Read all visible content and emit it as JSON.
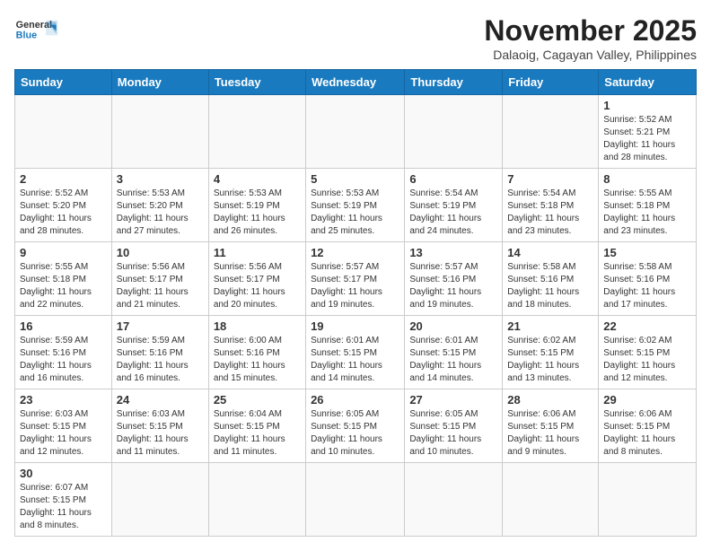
{
  "header": {
    "logo_general": "General",
    "logo_blue": "Blue",
    "month_title": "November 2025",
    "subtitle": "Dalaoig, Cagayan Valley, Philippines"
  },
  "weekdays": [
    "Sunday",
    "Monday",
    "Tuesday",
    "Wednesday",
    "Thursday",
    "Friday",
    "Saturday"
  ],
  "weeks": [
    [
      {
        "day": "",
        "info": ""
      },
      {
        "day": "",
        "info": ""
      },
      {
        "day": "",
        "info": ""
      },
      {
        "day": "",
        "info": ""
      },
      {
        "day": "",
        "info": ""
      },
      {
        "day": "",
        "info": ""
      },
      {
        "day": "1",
        "info": "Sunrise: 5:52 AM\nSunset: 5:21 PM\nDaylight: 11 hours\nand 28 minutes."
      }
    ],
    [
      {
        "day": "2",
        "info": "Sunrise: 5:52 AM\nSunset: 5:20 PM\nDaylight: 11 hours\nand 28 minutes."
      },
      {
        "day": "3",
        "info": "Sunrise: 5:53 AM\nSunset: 5:20 PM\nDaylight: 11 hours\nand 27 minutes."
      },
      {
        "day": "4",
        "info": "Sunrise: 5:53 AM\nSunset: 5:19 PM\nDaylight: 11 hours\nand 26 minutes."
      },
      {
        "day": "5",
        "info": "Sunrise: 5:53 AM\nSunset: 5:19 PM\nDaylight: 11 hours\nand 25 minutes."
      },
      {
        "day": "6",
        "info": "Sunrise: 5:54 AM\nSunset: 5:19 PM\nDaylight: 11 hours\nand 24 minutes."
      },
      {
        "day": "7",
        "info": "Sunrise: 5:54 AM\nSunset: 5:18 PM\nDaylight: 11 hours\nand 23 minutes."
      },
      {
        "day": "8",
        "info": "Sunrise: 5:55 AM\nSunset: 5:18 PM\nDaylight: 11 hours\nand 23 minutes."
      }
    ],
    [
      {
        "day": "9",
        "info": "Sunrise: 5:55 AM\nSunset: 5:18 PM\nDaylight: 11 hours\nand 22 minutes."
      },
      {
        "day": "10",
        "info": "Sunrise: 5:56 AM\nSunset: 5:17 PM\nDaylight: 11 hours\nand 21 minutes."
      },
      {
        "day": "11",
        "info": "Sunrise: 5:56 AM\nSunset: 5:17 PM\nDaylight: 11 hours\nand 20 minutes."
      },
      {
        "day": "12",
        "info": "Sunrise: 5:57 AM\nSunset: 5:17 PM\nDaylight: 11 hours\nand 19 minutes."
      },
      {
        "day": "13",
        "info": "Sunrise: 5:57 AM\nSunset: 5:16 PM\nDaylight: 11 hours\nand 19 minutes."
      },
      {
        "day": "14",
        "info": "Sunrise: 5:58 AM\nSunset: 5:16 PM\nDaylight: 11 hours\nand 18 minutes."
      },
      {
        "day": "15",
        "info": "Sunrise: 5:58 AM\nSunset: 5:16 PM\nDaylight: 11 hours\nand 17 minutes."
      }
    ],
    [
      {
        "day": "16",
        "info": "Sunrise: 5:59 AM\nSunset: 5:16 PM\nDaylight: 11 hours\nand 16 minutes."
      },
      {
        "day": "17",
        "info": "Sunrise: 5:59 AM\nSunset: 5:16 PM\nDaylight: 11 hours\nand 16 minutes."
      },
      {
        "day": "18",
        "info": "Sunrise: 6:00 AM\nSunset: 5:16 PM\nDaylight: 11 hours\nand 15 minutes."
      },
      {
        "day": "19",
        "info": "Sunrise: 6:01 AM\nSunset: 5:15 PM\nDaylight: 11 hours\nand 14 minutes."
      },
      {
        "day": "20",
        "info": "Sunrise: 6:01 AM\nSunset: 5:15 PM\nDaylight: 11 hours\nand 14 minutes."
      },
      {
        "day": "21",
        "info": "Sunrise: 6:02 AM\nSunset: 5:15 PM\nDaylight: 11 hours\nand 13 minutes."
      },
      {
        "day": "22",
        "info": "Sunrise: 6:02 AM\nSunset: 5:15 PM\nDaylight: 11 hours\nand 12 minutes."
      }
    ],
    [
      {
        "day": "23",
        "info": "Sunrise: 6:03 AM\nSunset: 5:15 PM\nDaylight: 11 hours\nand 12 minutes."
      },
      {
        "day": "24",
        "info": "Sunrise: 6:03 AM\nSunset: 5:15 PM\nDaylight: 11 hours\nand 11 minutes."
      },
      {
        "day": "25",
        "info": "Sunrise: 6:04 AM\nSunset: 5:15 PM\nDaylight: 11 hours\nand 11 minutes."
      },
      {
        "day": "26",
        "info": "Sunrise: 6:05 AM\nSunset: 5:15 PM\nDaylight: 11 hours\nand 10 minutes."
      },
      {
        "day": "27",
        "info": "Sunrise: 6:05 AM\nSunset: 5:15 PM\nDaylight: 11 hours\nand 10 minutes."
      },
      {
        "day": "28",
        "info": "Sunrise: 6:06 AM\nSunset: 5:15 PM\nDaylight: 11 hours\nand 9 minutes."
      },
      {
        "day": "29",
        "info": "Sunrise: 6:06 AM\nSunset: 5:15 PM\nDaylight: 11 hours\nand 8 minutes."
      }
    ],
    [
      {
        "day": "30",
        "info": "Sunrise: 6:07 AM\nSunset: 5:15 PM\nDaylight: 11 hours\nand 8 minutes."
      },
      {
        "day": "",
        "info": ""
      },
      {
        "day": "",
        "info": ""
      },
      {
        "day": "",
        "info": ""
      },
      {
        "day": "",
        "info": ""
      },
      {
        "day": "",
        "info": ""
      },
      {
        "day": "",
        "info": ""
      }
    ]
  ]
}
